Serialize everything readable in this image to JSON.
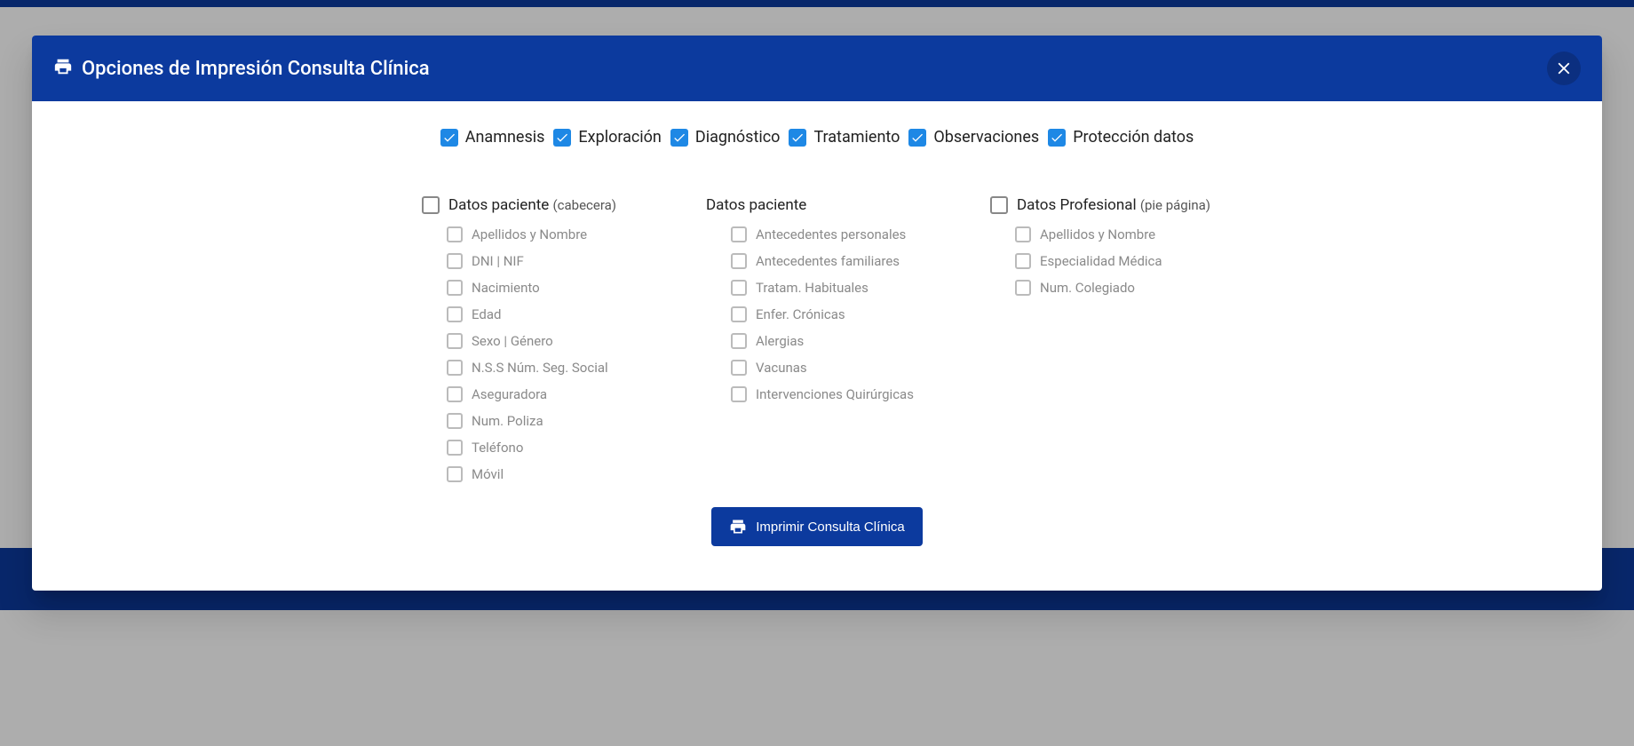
{
  "modal": {
    "title": "Opciones de Impresión Consulta Clínica"
  },
  "topOptions": {
    "anamnesis": "Anamnesis",
    "exploracion": "Exploración",
    "diagnostico": "Diagnóstico",
    "tratamiento": "Tratamiento",
    "observaciones": "Observaciones",
    "proteccion": "Protección datos"
  },
  "col1": {
    "header": "Datos paciente",
    "paren": "(cabecera)",
    "items": {
      "apellidosNombre": "Apellidos y Nombre",
      "dniNif": "DNI | NIF",
      "nacimiento": "Nacimiento",
      "edad": "Edad",
      "sexo": "Sexo | Género",
      "nss": "N.S.S Núm. Seg. Social",
      "aseguradora": "Aseguradora",
      "numPoliza": "Num. Poliza",
      "telefono": "Teléfono",
      "movil": "Móvil"
    }
  },
  "col2": {
    "header": "Datos paciente",
    "items": {
      "antPersonales": "Antecedentes personales",
      "antFamiliares": "Antecedentes familiares",
      "tratHabituales": "Tratam. Habituales",
      "enfCronicas": "Enfer. Crónicas",
      "alergias": "Alergias",
      "vacunas": "Vacunas",
      "intervQuirurgicas": "Intervenciones Quirúrgicas"
    }
  },
  "col3": {
    "header": "Datos Profesional",
    "paren": "(pie página)",
    "items": {
      "apellidosNombre": "Apellidos y Nombre",
      "especialidad": "Especialidad Médica",
      "numColegiado": "Num. Colegiado"
    }
  },
  "footer": {
    "printLabel": "Imprimir Consulta Clínica"
  }
}
